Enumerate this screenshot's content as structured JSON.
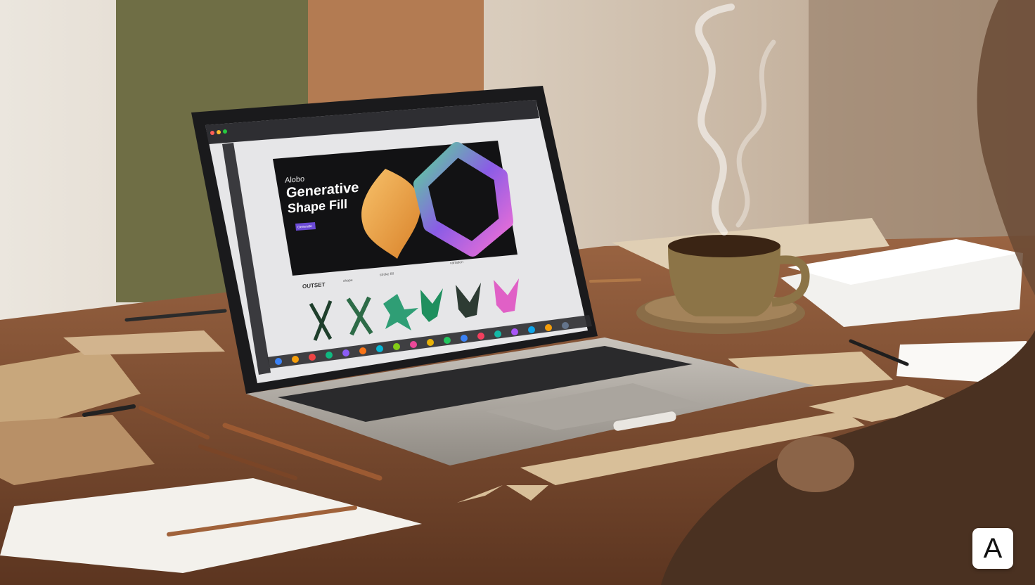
{
  "hero": {
    "brand": "Alobo",
    "title_line1": "Generative",
    "title_line2": "Shape Fill",
    "button_label": "Generate"
  },
  "gallery": {
    "heading": "OUTSET",
    "caption_1": "shape",
    "caption_2": "stroke fill",
    "caption_3": "variation"
  },
  "badge": {
    "label": "A"
  },
  "colors": {
    "wall": "#d8c9b8",
    "desk": "#7a4a2e",
    "laptop": "#b9b4ad",
    "hero_bg": "#121214",
    "accent_orange": "#f0a640",
    "accent_green": "#37c48a",
    "accent_pink": "#e96ad3",
    "accent_purple": "#7d4ae0",
    "coffee": "#7a6642"
  }
}
